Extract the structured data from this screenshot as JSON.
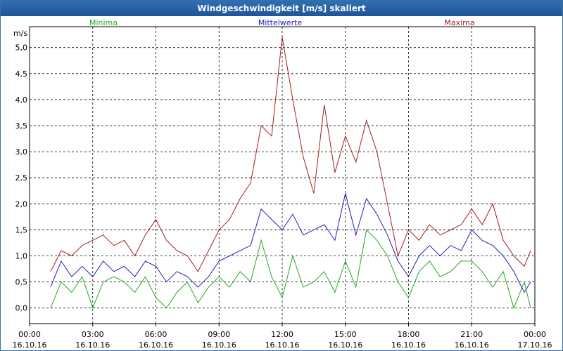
{
  "window": {
    "title": "Windgeschwindigkeit [m/s] skaliert"
  },
  "colors": {
    "minima": "#22aa22",
    "mittelwerte": "#1f1fb8",
    "maxima": "#a81c1c",
    "titlebar": "#2a64a8"
  },
  "chart_data": {
    "type": "line",
    "title": "Windgeschwindigkeit [m/s] skaliert",
    "ylabel": "m/s",
    "xlabel": "",
    "ylim": [
      -0.3,
      5.4
    ],
    "xlim_hours": [
      0,
      24
    ],
    "grid": true,
    "legend_position": "top",
    "y_ticks": [
      "0,0",
      "0,5",
      "1,0",
      "1,5",
      "2,0",
      "2,5",
      "3,0",
      "3,5",
      "4,0",
      "4,5",
      "5,0"
    ],
    "x_ticks": [
      {
        "time": "00:00",
        "date": "16.10.16"
      },
      {
        "time": "03:00",
        "date": "16.10.16"
      },
      {
        "time": "06:00",
        "date": "16.10.16"
      },
      {
        "time": "09:00",
        "date": "16.10.16"
      },
      {
        "time": "12:00",
        "date": "16.10.16"
      },
      {
        "time": "15:00",
        "date": "16.10.16"
      },
      {
        "time": "18:00",
        "date": "16.10.16"
      },
      {
        "time": "21:00",
        "date": "16.10.16"
      },
      {
        "time": "00:00",
        "date": "17.10.16"
      }
    ],
    "series": [
      {
        "name": "Minima",
        "color": "#22aa22",
        "x_hours": [
          1.0,
          1.5,
          2.0,
          2.5,
          3.0,
          3.5,
          4.0,
          4.5,
          5.0,
          5.5,
          6.0,
          6.5,
          7.0,
          7.5,
          8.0,
          8.5,
          9.0,
          9.5,
          10.0,
          10.5,
          11.0,
          11.5,
          12.0,
          12.5,
          13.0,
          13.5,
          14.0,
          14.5,
          15.0,
          15.5,
          16.0,
          16.5,
          17.0,
          17.5,
          18.0,
          18.5,
          19.0,
          19.5,
          20.0,
          20.5,
          21.0,
          21.5,
          22.0,
          22.5,
          23.0,
          23.5,
          23.8
        ],
        "values": [
          0.0,
          0.5,
          0.3,
          0.6,
          0.0,
          0.5,
          0.6,
          0.5,
          0.3,
          0.6,
          0.2,
          0.0,
          0.3,
          0.5,
          0.1,
          0.4,
          0.6,
          0.4,
          0.7,
          0.5,
          1.3,
          0.6,
          0.2,
          1.0,
          0.4,
          0.5,
          0.7,
          0.3,
          0.9,
          0.4,
          1.5,
          1.3,
          1.0,
          0.5,
          0.2,
          0.7,
          0.9,
          0.6,
          0.7,
          0.9,
          0.9,
          0.7,
          0.4,
          0.7,
          0.0,
          0.5,
          0.0
        ]
      },
      {
        "name": "Mittelwerte",
        "color": "#1f1fb8",
        "x_hours": [
          1.0,
          1.5,
          2.0,
          2.5,
          3.0,
          3.5,
          4.0,
          4.5,
          5.0,
          5.5,
          6.0,
          6.5,
          7.0,
          7.5,
          8.0,
          8.5,
          9.0,
          9.5,
          10.0,
          10.5,
          11.0,
          11.5,
          12.0,
          12.5,
          13.0,
          13.5,
          14.0,
          14.5,
          15.0,
          15.5,
          16.0,
          16.5,
          17.0,
          17.5,
          18.0,
          18.5,
          19.0,
          19.5,
          20.0,
          20.5,
          21.0,
          21.5,
          22.0,
          22.5,
          23.0,
          23.5,
          23.8
        ],
        "values": [
          0.4,
          0.9,
          0.6,
          0.8,
          0.6,
          0.9,
          0.7,
          0.8,
          0.6,
          0.9,
          0.8,
          0.5,
          0.7,
          0.6,
          0.4,
          0.6,
          0.9,
          1.0,
          1.1,
          1.2,
          1.9,
          1.7,
          1.5,
          1.8,
          1.4,
          1.5,
          1.6,
          1.3,
          2.2,
          1.4,
          2.1,
          1.8,
          1.4,
          0.9,
          0.6,
          1.0,
          1.2,
          1.0,
          1.2,
          1.1,
          1.5,
          1.3,
          1.2,
          1.0,
          0.7,
          0.3,
          0.5
        ]
      },
      {
        "name": "Maxima",
        "color": "#a81c1c",
        "x_hours": [
          1.0,
          1.5,
          2.0,
          2.5,
          3.0,
          3.5,
          4.0,
          4.5,
          5.0,
          5.5,
          6.0,
          6.5,
          7.0,
          7.5,
          8.0,
          8.5,
          9.0,
          9.5,
          10.0,
          10.5,
          11.0,
          11.5,
          12.0,
          12.5,
          13.0,
          13.5,
          14.0,
          14.5,
          15.0,
          15.5,
          16.0,
          16.5,
          17.0,
          17.5,
          18.0,
          18.5,
          19.0,
          19.5,
          20.0,
          20.5,
          21.0,
          21.5,
          22.0,
          22.5,
          23.0,
          23.5,
          23.8
        ],
        "values": [
          0.7,
          1.1,
          1.0,
          1.2,
          1.3,
          1.4,
          1.2,
          1.3,
          1.0,
          1.4,
          1.7,
          1.3,
          1.1,
          1.0,
          0.7,
          1.1,
          1.5,
          1.7,
          2.1,
          2.4,
          3.5,
          3.3,
          5.2,
          4.0,
          2.9,
          2.2,
          3.9,
          2.6,
          3.3,
          2.8,
          3.6,
          3.0,
          2.0,
          1.0,
          1.5,
          1.3,
          1.6,
          1.4,
          1.5,
          1.6,
          1.9,
          1.6,
          2.0,
          1.3,
          1.0,
          0.8,
          1.1
        ]
      }
    ]
  }
}
